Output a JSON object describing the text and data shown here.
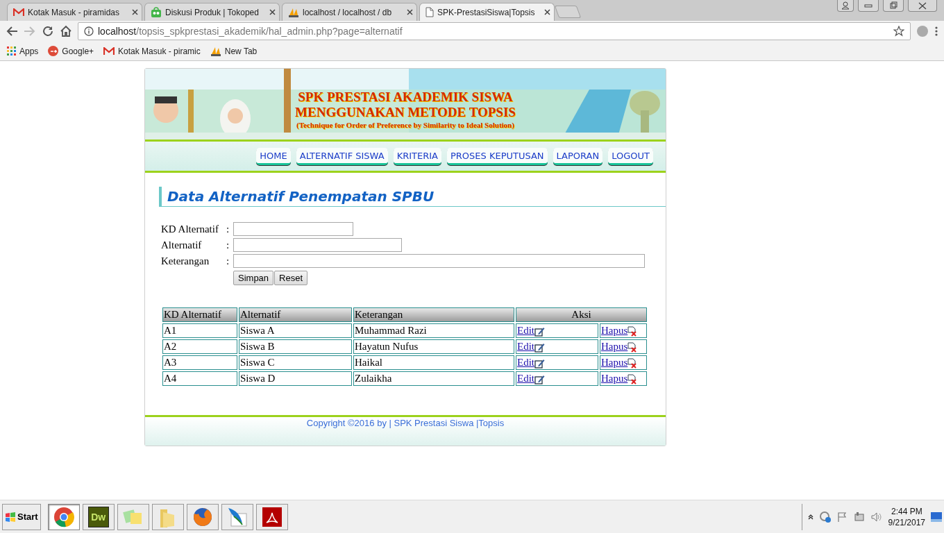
{
  "browser": {
    "tabs": [
      {
        "title": "Kotak Masuk - piramidas",
        "selected": false
      },
      {
        "title": "Diskusi Produk | Tokoped",
        "selected": false
      },
      {
        "title": "localhost / localhost / db",
        "selected": false
      },
      {
        "title": "SPK-PrestasiSiswa|Topsis",
        "selected": true
      }
    ],
    "address": {
      "host": "localhost",
      "path": "/topsis_spkprestasi_akademik/hal_admin.php?page=alternatif"
    },
    "bookmarks": [
      "Apps",
      "Google+",
      "Kotak Masuk - piramic",
      "New Tab"
    ]
  },
  "header": {
    "title_lines": [
      "SPK PRESTASI AKADEMIK SISWA",
      "MENGGUNAKAN METODE TOPSIS"
    ],
    "subtitle": "(Technique for Order of Preference by Similarity to Ideal Solution)"
  },
  "nav": [
    "HOME",
    "ALTERNATIF SISWA",
    "KRITERIA",
    "PROSES KEPUTUSAN",
    "LAPORAN",
    "LOGOUT"
  ],
  "heading": "Data Alternatif Penempatan SPBU",
  "form": {
    "fields": [
      {
        "label": "KD Alternatif"
      },
      {
        "label": "Alternatif"
      },
      {
        "label": "Keterangan"
      }
    ],
    "separator": ":",
    "buttons": [
      "Simpan",
      "Reset"
    ]
  },
  "table": {
    "columns": [
      "KD Alternatif",
      "Alternatif",
      "Keterangan",
      "Aksi"
    ],
    "rows": [
      {
        "cells": [
          "A1",
          "Siswa A",
          "Muhammad Razi"
        ],
        "actions": [
          "Edit",
          "Hapus"
        ]
      },
      {
        "cells": [
          "A2",
          "Siswa B",
          "Hayatun Nufus"
        ],
        "actions": [
          "Edit",
          "Hapus"
        ]
      },
      {
        "cells": [
          "A3",
          "Siswa C",
          "Haikal"
        ],
        "actions": [
          "Edit",
          "Hapus"
        ]
      },
      {
        "cells": [
          "A4",
          "Siswa D",
          "Zulaikha"
        ],
        "actions": [
          "Edit",
          "Hapus"
        ]
      }
    ]
  },
  "footer": "Copyright ©2016 by | SPK Prestasi Siswa |Topsis",
  "taskbar": {
    "start": "Start",
    "apps": [
      {
        "kind": "chrome",
        "selected": true
      },
      {
        "kind": "dw",
        "label": "Dw",
        "selected": false
      },
      {
        "kind": "windows",
        "selected": false
      },
      {
        "kind": "folder",
        "selected": false
      },
      {
        "kind": "firefox",
        "selected": false
      },
      {
        "kind": "feather",
        "selected": false
      },
      {
        "kind": "pdf",
        "selected": false
      }
    ],
    "time": "2:44 PM",
    "date": "9/21/2017"
  }
}
